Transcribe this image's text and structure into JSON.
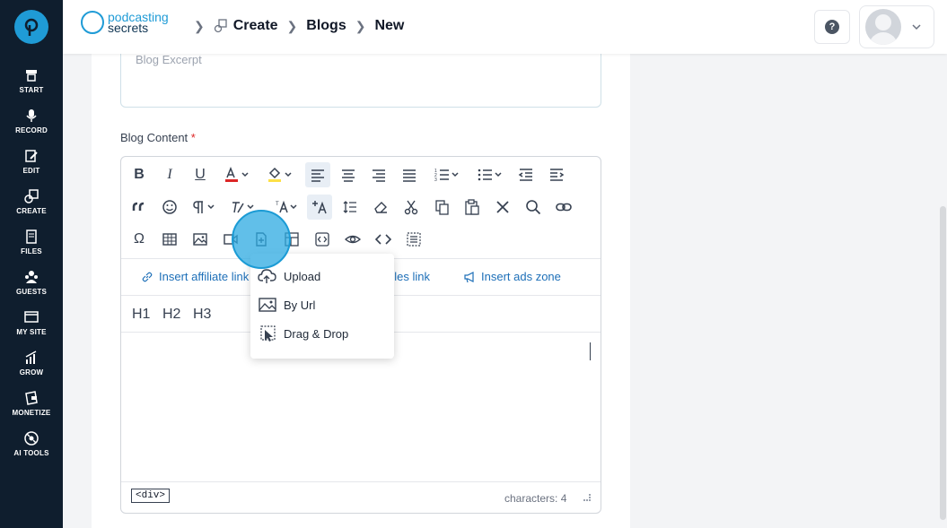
{
  "sidebar": {
    "items": [
      {
        "label": "START",
        "icon": "start-icon"
      },
      {
        "label": "RECORD",
        "icon": "microphone-icon"
      },
      {
        "label": "EDIT",
        "icon": "edit-icon"
      },
      {
        "label": "CREATE",
        "icon": "create-icon"
      },
      {
        "label": "FILES",
        "icon": "files-icon"
      },
      {
        "label": "GUESTS",
        "icon": "guests-icon"
      },
      {
        "label": "MY SITE",
        "icon": "my-site-icon"
      },
      {
        "label": "GROW",
        "icon": "grow-icon"
      },
      {
        "label": "MONETIZE",
        "icon": "monetize-icon"
      },
      {
        "label": "AI TOOLS",
        "icon": "ai-tools-icon"
      }
    ]
  },
  "header": {
    "brand_line1": "podcasting",
    "brand_line2": "secrets",
    "breadcrumb": [
      "Create",
      "Blogs",
      "New"
    ],
    "help_label": "?"
  },
  "form": {
    "excerpt_placeholder": "Blog Excerpt",
    "content_label": "Blog Content",
    "required_mark": "*"
  },
  "editor": {
    "links": {
      "affiliate": "Insert affiliate link",
      "samples": "ples link",
      "ads": "Insert ads zone"
    },
    "headings": [
      "H1",
      "H2",
      "H3"
    ],
    "status_tag": "<div>",
    "char_count": "characters: 4"
  },
  "insert_menu": {
    "items": [
      "Upload",
      "By Url",
      "Drag & Drop"
    ]
  },
  "colors": {
    "sidebar": "#0f1e2e",
    "accent": "#1f9bd6",
    "link": "#1d6fb8",
    "required": "#dc2626"
  }
}
